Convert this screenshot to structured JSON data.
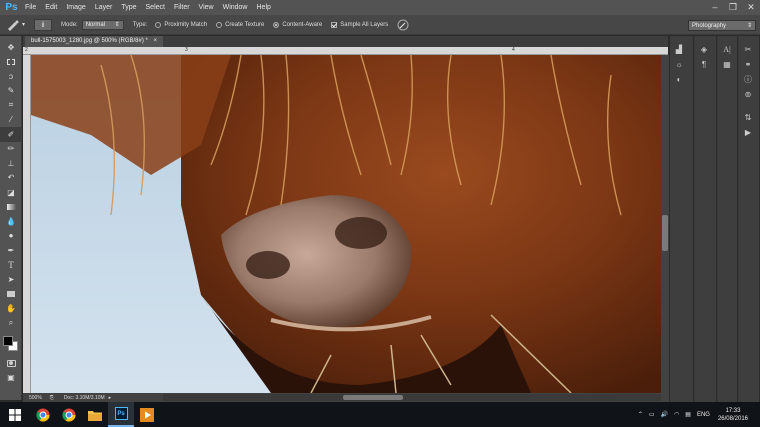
{
  "app": {
    "logo": "Ps"
  },
  "menu": [
    "File",
    "Edit",
    "Image",
    "Layer",
    "Type",
    "Select",
    "Filter",
    "View",
    "Window",
    "Help"
  ],
  "window_controls": {
    "minimize": "–",
    "restore": "❐",
    "close": "✕"
  },
  "options": {
    "brush_size": "8",
    "mode_label": "Mode:",
    "mode_value": "Normal",
    "type_label": "Type:",
    "type_options": [
      "Proximity Match",
      "Create Texture",
      "Content-Aware"
    ],
    "type_selected": 2,
    "sample_all_layers": "Sample All Layers",
    "sample_all_checked": true
  },
  "workspace": "Photography",
  "document": {
    "tab_title": "bull-1575003_1280.jpg @ 500% (RGB/8#) *",
    "close": "×",
    "ruler_numbers": [
      "2",
      "3",
      "4"
    ],
    "zoom": "500%",
    "doc_info": "Doc: 3.10M/3.10M"
  },
  "tools": [
    "move-tool",
    "marquee-tool",
    "lasso-tool",
    "quick-selection-tool",
    "crop-tool",
    "eyedropper-tool",
    "spot-healing-brush-tool",
    "brush-tool",
    "clone-stamp-tool",
    "history-brush-tool",
    "eraser-tool",
    "gradient-tool",
    "blur-tool",
    "dodge-tool",
    "pen-tool",
    "type-tool",
    "path-selection-tool",
    "rectangle-tool",
    "hand-tool",
    "zoom-tool"
  ],
  "active_tool": "spot-healing-brush-tool",
  "taskbar": {
    "apps": [
      "windows-start",
      "chrome",
      "chrome",
      "file-explorer",
      "photoshop",
      "media-player"
    ],
    "active_app": "photoshop",
    "language": "ENG",
    "time": "17:33",
    "date": "26/08/2016"
  },
  "colors": {
    "accent_ps": "#4db8ff",
    "panel_bg": "#535353",
    "taskbar_bg": "#101418"
  }
}
